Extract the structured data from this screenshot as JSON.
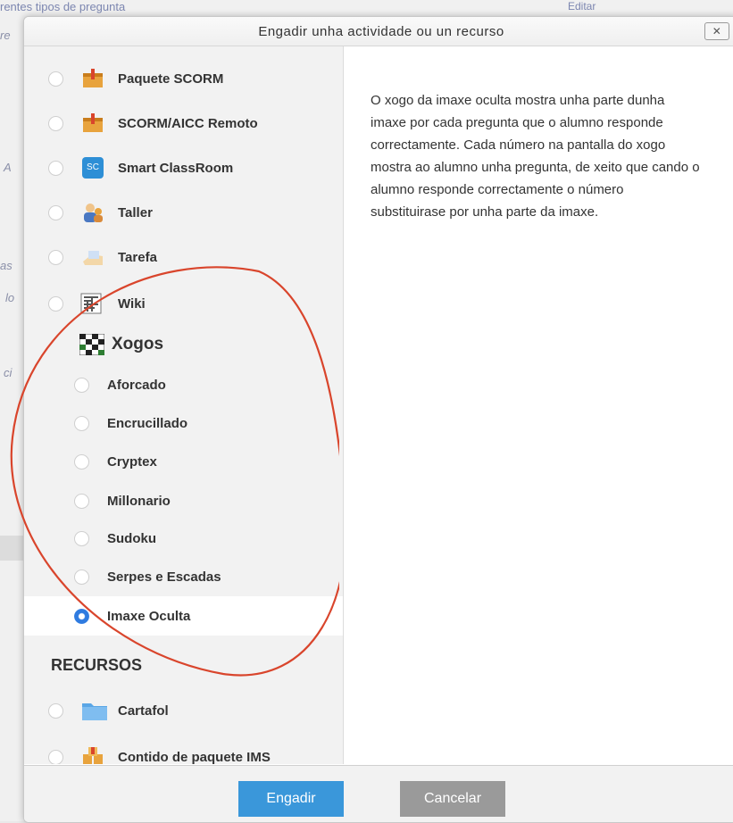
{
  "background": {
    "top_text": "rentes tipos de pregunta",
    "top_right_text": "Editar",
    "side_fragments": [
      "re",
      "A",
      "as",
      "lo",
      "ci"
    ]
  },
  "modal": {
    "title": "Engadir unha actividade ou un recurso",
    "close_label": "✕",
    "description": "O xogo da imaxe oculta mostra unha parte dunha imaxe por cada pregunta que o alumno responde correctamente. Cada número na pantalla do xogo mostra ao alumno unha pregunta, de xeito que cando o alumno responde correctamente o número substituirase por unha parte da imaxe."
  },
  "activities": [
    {
      "label": "Paquete SCORM",
      "icon": "scorm-package-icon"
    },
    {
      "label": "SCORM/AICC Remoto",
      "icon": "scorm-remote-icon"
    },
    {
      "label": "Smart ClassRoom",
      "icon": "smart-classroom-icon"
    },
    {
      "label": "Taller",
      "icon": "workshop-icon"
    },
    {
      "label": "Tarefa",
      "icon": "assignment-icon"
    },
    {
      "label": "Wiki",
      "icon": "wiki-icon"
    }
  ],
  "games_group": {
    "title": "Xogos",
    "icon": "games-icon",
    "items": [
      {
        "label": "Aforcado",
        "selected": false
      },
      {
        "label": "Encrucillado",
        "selected": false
      },
      {
        "label": "Cryptex",
        "selected": false
      },
      {
        "label": "Millonario",
        "selected": false
      },
      {
        "label": "Sudoku",
        "selected": false
      },
      {
        "label": "Serpes e Escadas",
        "selected": false
      },
      {
        "label": "Imaxe Oculta",
        "selected": true
      }
    ]
  },
  "resources": {
    "title": "RECURSOS",
    "items": [
      {
        "label": "Cartafol",
        "icon": "folder-icon"
      },
      {
        "label": "Contido de paquete IMS",
        "icon": "ims-package-icon"
      }
    ]
  },
  "footer": {
    "add_label": "Engadir",
    "cancel_label": "Cancelar"
  },
  "colors": {
    "primary_button": "#3a97da",
    "secondary_button": "#9a9a9a",
    "selected_radio": "#2f7be0",
    "annotation_circle": "#d9452c"
  }
}
